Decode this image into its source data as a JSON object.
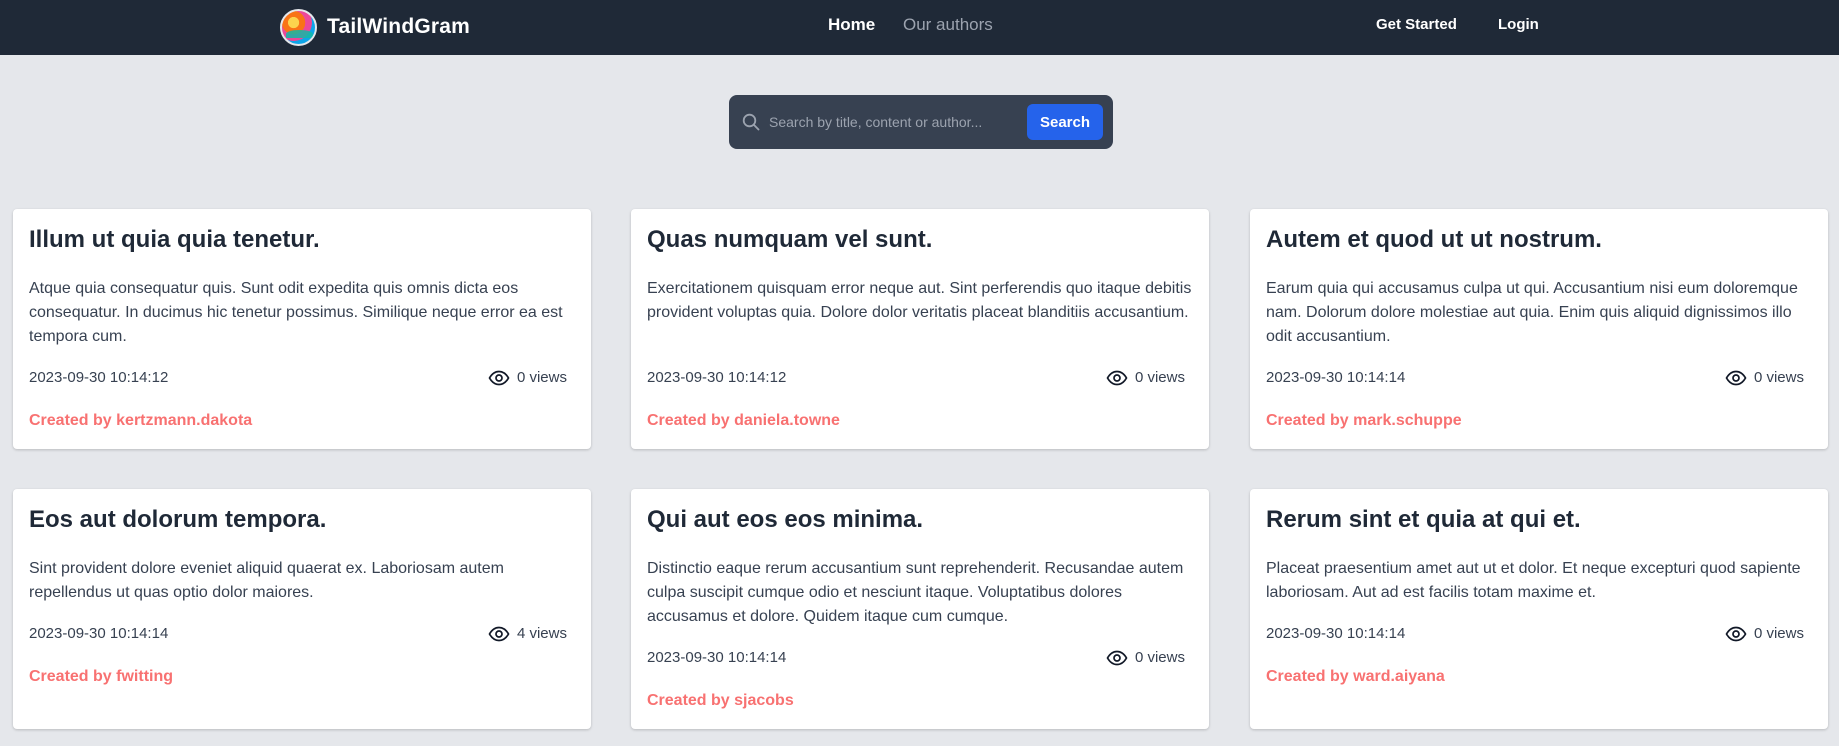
{
  "brand": {
    "name": "TailWindGram"
  },
  "nav": {
    "home": "Home",
    "authors": "Our authors",
    "get_started": "Get Started",
    "login": "Login"
  },
  "search": {
    "placeholder": "Search by title, content or author...",
    "button": "Search"
  },
  "colors": {
    "navbar": "#1f2937",
    "accent": "#2563eb",
    "author": "#f87171",
    "background": "#e5e7eb"
  },
  "posts": [
    {
      "title": "Illum ut quia quia tenetur.",
      "body": "Atque quia consequatur quis. Sunt odit expedita quis omnis dicta eos consequatur. In ducimus hic tenetur possimus. Similique neque error ea est tempora cum.",
      "date": "2023-09-30 10:14:12",
      "views": "0 views",
      "author": "Created by kertzmann.dakota"
    },
    {
      "title": "Quas numquam vel sunt.",
      "body": "Exercitationem quisquam error neque aut. Sint perferendis quo itaque debitis provident voluptas quia. Dolore dolor veritatis placeat blanditiis accusantium.",
      "date": "2023-09-30 10:14:12",
      "views": "0 views",
      "author": "Created by daniela.towne"
    },
    {
      "title": "Autem et quod ut ut nostrum.",
      "body": "Earum quia qui accusamus culpa ut qui. Accusantium nisi eum doloremque nam. Dolorum dolore molestiae aut quia. Enim quis aliquid dignissimos illo odit accusantium.",
      "date": "2023-09-30 10:14:14",
      "views": "0 views",
      "author": "Created by mark.schuppe"
    },
    {
      "title": "Eos aut dolorum tempora.",
      "body": "Sint provident dolore eveniet aliquid quaerat ex. Laboriosam autem repellendus ut quas optio dolor maiores.",
      "date": "2023-09-30 10:14:14",
      "views": "4 views",
      "author": "Created by fwitting"
    },
    {
      "title": "Qui aut eos eos minima.",
      "body": "Distinctio eaque rerum accusantium sunt reprehenderit. Recusandae autem culpa suscipit cumque odio et nesciunt itaque. Voluptatibus dolores accusamus et dolore. Quidem itaque cum cumque.",
      "date": "2023-09-30 10:14:14",
      "views": "0 views",
      "author": "Created by sjacobs"
    },
    {
      "title": "Rerum sint et quia at qui et.",
      "body": "Placeat praesentium amet aut ut et dolor. Et neque excepturi quod sapiente laboriosam. Aut ad est facilis totam maxime et.",
      "date": "2023-09-30 10:14:14",
      "views": "0 views",
      "author": "Created by ward.aiyana"
    }
  ]
}
